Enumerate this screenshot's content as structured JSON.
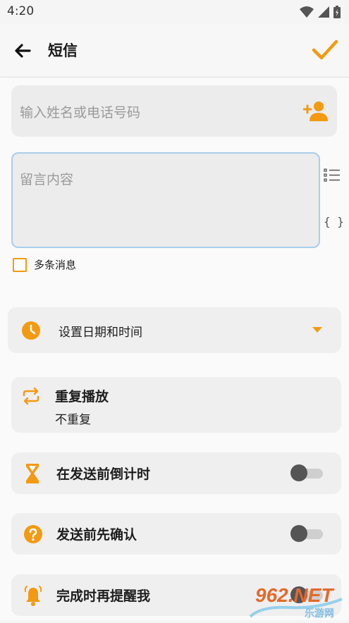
{
  "status_bar": {
    "time": "4:20"
  },
  "app_bar": {
    "title": "短信"
  },
  "recipient": {
    "placeholder": "输入姓名或电话号码"
  },
  "message": {
    "placeholder": "留言内容",
    "braces": "{ }"
  },
  "multi_message": {
    "label": "多条消息",
    "checked": false
  },
  "schedule": {
    "label": "设置日期和时间"
  },
  "repeat": {
    "title": "重复播放",
    "subtitle": "不重复"
  },
  "countdown": {
    "label": "在发送前倒计时",
    "enabled": false
  },
  "confirm_before_send": {
    "label": "发送前先确认",
    "enabled": false
  },
  "remind": {
    "label": "完成时再提醒我",
    "enabled": false
  },
  "watermark": {
    "brand": "962.NET",
    "site": "乐游网"
  },
  "colors": {
    "accent": "#f39a12",
    "card": "#efefef",
    "focus_border": "#a9cdeb"
  }
}
